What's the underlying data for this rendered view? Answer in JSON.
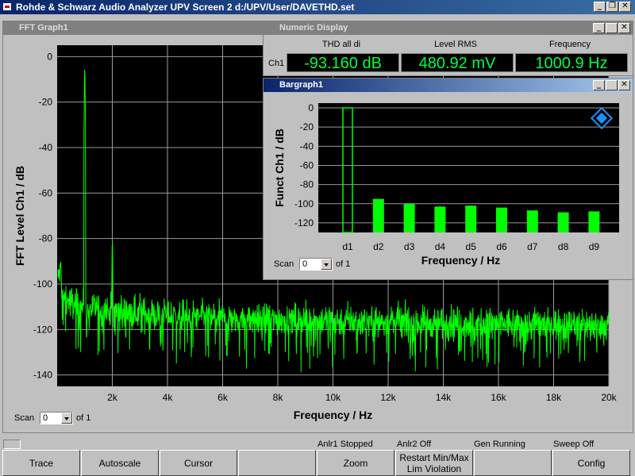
{
  "app": {
    "title": "Rohde & Schwarz Audio Analyzer UPV Screen 2  d:/UPV/User/DAVETHD.set",
    "min": "_",
    "max": "❐",
    "close": "✕"
  },
  "fft": {
    "title": "FFT Graph1",
    "scan_label": "Scan",
    "scan_value": "0",
    "scan_of": "of 1",
    "chart_data": {
      "type": "line",
      "xlabel": "Frequency / Hz",
      "ylabel": "FFT Level Ch1 / dB",
      "xlim": [
        0,
        20000
      ],
      "ylim": [
        -145,
        5
      ],
      "xticks": [
        "2k",
        "4k",
        "6k",
        "8k",
        "10k",
        "12k",
        "14k",
        "16k",
        "18k",
        "20k"
      ],
      "yticks": [
        "0",
        "-20",
        "-40",
        "-60",
        "-80",
        "-100",
        "-120",
        "-140"
      ],
      "grid": true,
      "series": [
        {
          "color": "#00ff00",
          "description": "FFT spectrum: fundamental ~0 dB at 1 kHz, harmonics at 2k/3k/4k Hz, noise floor ~-115 to -125 dB"
        }
      ]
    }
  },
  "numeric": {
    "title": "Numeric Display",
    "headers": [
      "THD all di",
      "Level RMS",
      "Frequency"
    ],
    "channel": "Ch1",
    "values": [
      "-93.160 dB",
      "480.92 mV",
      "1000.9 Hz"
    ]
  },
  "bargraph": {
    "title": "Bargraph1",
    "scan_label": "Scan",
    "scan_value": "0",
    "scan_of": "of 1",
    "chart_data": {
      "type": "bar",
      "xlabel": "Frequency / Hz",
      "ylabel": "Funct Ch1 / dB",
      "ylim": [
        -130,
        5
      ],
      "yticks": [
        "0",
        "-20",
        "-40",
        "-60",
        "-80",
        "-100",
        "-120"
      ],
      "categories": [
        "d1",
        "d2",
        "d3",
        "d4",
        "d5",
        "d6",
        "d7",
        "d8",
        "d9"
      ],
      "values": [
        0,
        -95,
        -100,
        -103,
        -102,
        -104,
        -107,
        -109,
        -108
      ],
      "bar_color": "#00ff00",
      "grid": true
    }
  },
  "status": {
    "anlr1": "Anlr1 Stopped",
    "anlr2": "Anlr2 Off",
    "gen": "Gen Running",
    "sweep": "Sweep Off"
  },
  "softkeys": [
    "Trace",
    "Autoscale",
    "Cursor",
    "",
    "Zoom",
    "Restart Min/Max\nLim Violation",
    "",
    "Config"
  ]
}
